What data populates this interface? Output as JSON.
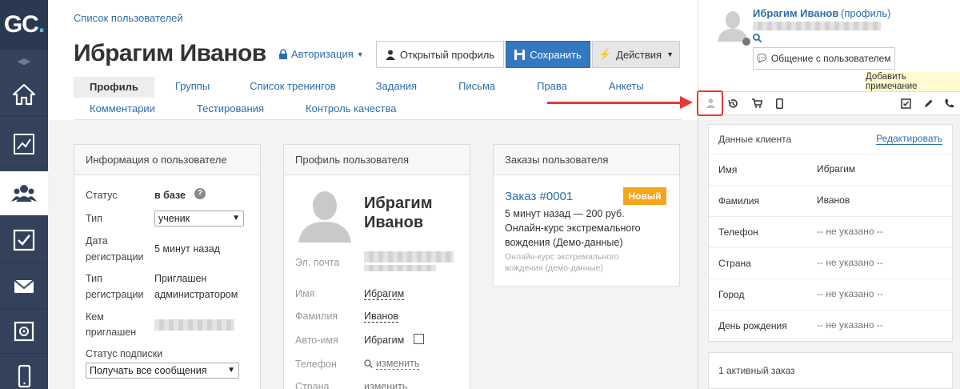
{
  "app": {
    "logo_text": "GC",
    "logo_dot": "."
  },
  "sidebar": {
    "items": [
      {
        "name": "home-icon",
        "active": false
      },
      {
        "name": "chart-icon",
        "active": false
      },
      {
        "name": "users-icon",
        "active": true
      },
      {
        "name": "tasks-icon",
        "active": false
      },
      {
        "name": "mail-icon",
        "active": false
      },
      {
        "name": "safe-icon",
        "active": false
      },
      {
        "name": "mobile-icon",
        "active": false
      }
    ]
  },
  "header": {
    "breadcrumb": "Список пользователей",
    "title": "Ибрагим Иванов",
    "auth_label": "Авторизация",
    "open_profile_label": "Открытый профиль",
    "save_label": "Сохранить",
    "actions_label": "Действия"
  },
  "tabs": {
    "row1": [
      "Профиль",
      "Группы",
      "Список тренингов",
      "Задания",
      "Письма",
      "Права",
      "Анкеты"
    ],
    "row2": [
      "Комментарии",
      "Тестирования",
      "Контроль качества"
    ],
    "active": "Профиль"
  },
  "info_panel": {
    "title": "Информация о пользователе",
    "status_label": "Статус",
    "status_value": "в базе",
    "type_label": "Тип",
    "type_value": "ученик",
    "reg_date_label_1": "Дата",
    "reg_date_label_2": "регистрации",
    "reg_date_value": "5 минут назад",
    "reg_type_label_1": "Тип",
    "reg_type_label_2": "регистрации",
    "reg_type_value_1": "Приглашен",
    "reg_type_value_2": "администратором",
    "invited_label_1": "Кем",
    "invited_label_2": "приглашен",
    "subscription_label": "Статус подписки",
    "subscription_value": "Получать все сообщения"
  },
  "profile_panel": {
    "title": "Профиль пользователя",
    "name_line1": "Ибрагим",
    "name_line2": "Иванов",
    "email_label": "Эл. почта",
    "first_name_label": "Имя",
    "first_name_value": "Ибрагим",
    "last_name_label": "Фамилия",
    "last_name_value": "Иванов",
    "auto_name_label": "Авто-имя",
    "auto_name_value": "Ибрагим",
    "phone_label": "Телефон",
    "phone_action": "изменить",
    "country_label": "Страна",
    "country_action": "изменить"
  },
  "orders_panel": {
    "title": "Заказы пользователя",
    "order_link": "Заказ #0001",
    "order_badge": "Новый",
    "order_line1": "5 минут назад — 200 руб.",
    "order_line2": "Онлайн-курс экстремального",
    "order_line3": "вождения (Демо-данные)",
    "order_sub1": "Онлайн-курс экстремального",
    "order_sub2": "вождения (демо-данные)"
  },
  "right_panel": {
    "user_name": "Ибрагим Иванов",
    "profile_link": "(профиль)",
    "chat_button": "Общение с пользователем",
    "add_note": "Добавить примечание",
    "card_title": "Данные клиента",
    "edit_link": "Редактировать",
    "rows": [
      {
        "key": "Имя",
        "value": "Ибрагим",
        "muted": false
      },
      {
        "key": "Фамилия",
        "value": "Иванов",
        "muted": false
      },
      {
        "key": "Телефон",
        "value": "-- не указано --",
        "muted": true
      },
      {
        "key": "Страна",
        "value": "-- не указано --",
        "muted": true
      },
      {
        "key": "Город",
        "value": "-- не указано --",
        "muted": true
      },
      {
        "key": "День рождения",
        "value": "-- не указано --",
        "muted": true
      }
    ],
    "active_orders": "1 активный заказ"
  },
  "colors": {
    "sidebar": "#33415a",
    "accent": "#3478c0",
    "link": "#2d6ea8",
    "badge": "#f4a51c",
    "annotation": "#e53935"
  }
}
